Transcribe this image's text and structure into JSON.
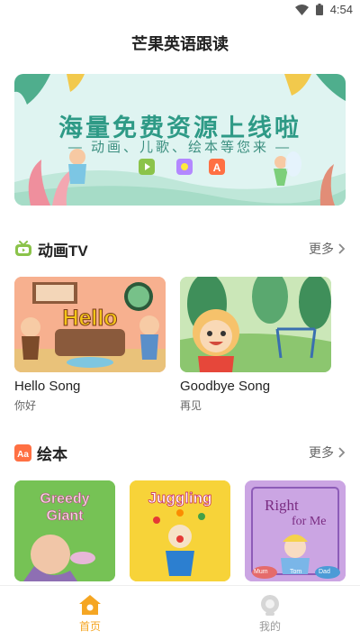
{
  "status": {
    "time": "4:54"
  },
  "header": {
    "title": "芒果英语跟读"
  },
  "banner": {
    "headline": "海量免费资源上线啦",
    "subline": "— 动画、儿歌、绘本等您来 —"
  },
  "sections": {
    "animation": {
      "title": "动画TV",
      "more": "更多"
    },
    "picture_books": {
      "title": "绘本",
      "more": "更多"
    }
  },
  "videos": [
    {
      "title": "Hello Song",
      "subtitle": "你好",
      "thumb_text": "Hello"
    },
    {
      "title": "Goodbye Song",
      "subtitle": "再见"
    }
  ],
  "books": [
    {
      "cover_text_1": "Greedy",
      "cover_text_2": "Giant"
    },
    {
      "cover_text_1": "Juggling"
    },
    {
      "cover_text_1": "Right",
      "cover_text_2": "for Me",
      "caption_1": "Mum",
      "caption_2": "Tom",
      "caption_3": "Dad"
    }
  ],
  "tabbar": {
    "home": "首页",
    "mine": "我的"
  },
  "colors": {
    "accent": "#f5a623",
    "banner_bg": "#dff4f1",
    "banner_text": "#2e9a86",
    "tab_inactive": "#999999"
  }
}
